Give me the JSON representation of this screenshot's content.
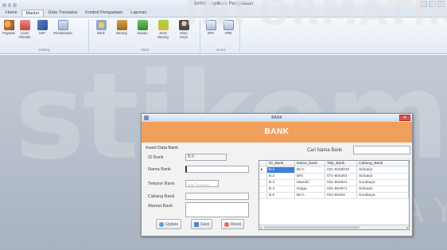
{
  "app": {
    "title": "BANK - Aplikasi Pengadaan"
  },
  "ribbon": {
    "tabs": [
      {
        "label": "Home"
      },
      {
        "label": "Master"
      },
      {
        "label": "Data Transaksi"
      },
      {
        "label": "Kontrol Pengadaan"
      },
      {
        "label": "Laporan"
      }
    ],
    "active_tab": "Master",
    "groups": [
      {
        "title": "Setting",
        "buttons": [
          "Pegawai",
          "Level Otoritas",
          "SKP",
          "Pembobotan"
        ]
      },
      {
        "title": "Data",
        "buttons": [
          "Bank",
          "Barang",
          "Satuan",
          "Jenis Barang",
          "Mitra Kerja"
        ]
      },
      {
        "title": "Surat",
        "buttons": [
          "SPH",
          "SPB"
        ]
      }
    ]
  },
  "watermark": {
    "top": "INFORMATIK",
    "big": "stikom",
    "sub": "SURABAYA"
  },
  "dialog": {
    "window_title": "BANK",
    "header": "BANK",
    "section_label": "Insert Data Bank",
    "fields": {
      "id_bank": {
        "label": "ID Bank",
        "value": "B.6"
      },
      "nama_bank": {
        "label": "Nama Bank",
        "value": ""
      },
      "telepon_bank": {
        "label": "Telepon Bank",
        "value": ""
      },
      "cabang_bank": {
        "label": "Cabang Bank",
        "value": ""
      },
      "alamat_bank": {
        "label": "Alamat Bank",
        "value": ""
      }
    },
    "buttons": {
      "update": "Update",
      "save": "Save",
      "reset": "Reset"
    },
    "search": {
      "label": "Cari Nama Bank",
      "value": ""
    },
    "table": {
      "columns": [
        "ID_Bank",
        "Nama_bank",
        "Telp_Bank",
        "Cabang_Bank"
      ],
      "rows": [
        [
          "B.1",
          "BCA",
          "031-5029034",
          "Sidoarjo"
        ],
        [
          "B.2",
          "BRI",
          "071-654364",
          "Sidoarjo"
        ],
        [
          "B.3",
          "Mandiri",
          "031-552921",
          "Surabaya"
        ],
        [
          "B.4",
          "Niaga",
          "031-552971",
          "Sidoarjo"
        ],
        [
          "B.5",
          "BCA",
          "031-55262",
          "Surabaya"
        ]
      ],
      "selected_row": 0
    }
  },
  "colors": {
    "header_orange": "#f0a05c",
    "selection_blue": "#3e7fd8",
    "workspace": "#b4bdc9"
  }
}
